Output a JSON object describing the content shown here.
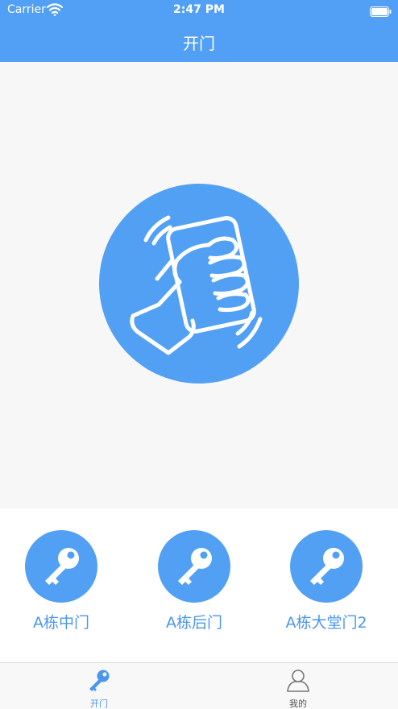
{
  "status_bar": {
    "carrier": "Carrier",
    "time": "2:47 PM"
  },
  "nav": {
    "title": "开门"
  },
  "main": {
    "shake_icon": "hand-shaking-phone-icon"
  },
  "doors": [
    {
      "label": "A栋中门",
      "icon": "key-icon"
    },
    {
      "label": "A栋后门",
      "icon": "key-icon"
    },
    {
      "label": "A栋大堂门2",
      "icon": "key-icon"
    }
  ],
  "tabbar": {
    "tabs": [
      {
        "label": "开门",
        "icon": "key-icon",
        "selected": true
      },
      {
        "label": "我的",
        "icon": "person-icon",
        "selected": false
      }
    ]
  },
  "colors": {
    "accent": "#51a0f5",
    "door_label": "#4a96ec",
    "tab_selected": "#4a96ec",
    "tab_unselected": "#555555",
    "background": "#f7f7f7"
  }
}
